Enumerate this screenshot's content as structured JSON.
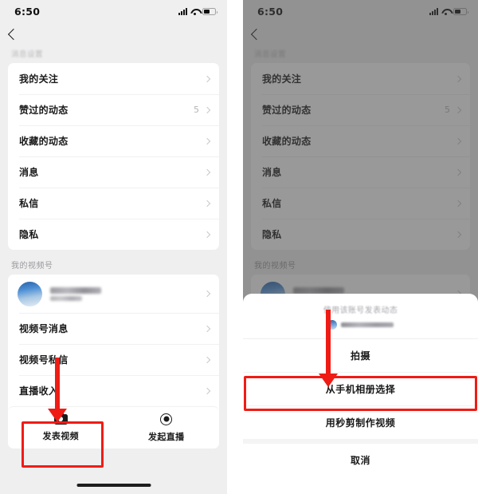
{
  "meta": {
    "status_time": "6:50",
    "accent_red": "#ef1c15",
    "panel_bg": "#efeff0",
    "card_bg": "#ffffff"
  },
  "icons": {
    "back": "back-chevron-icon",
    "signal": "signal-bars-icon",
    "wifi": "wifi-icon",
    "battery": "battery-icon",
    "camera": "camera-icon",
    "live": "live-broadcast-icon",
    "chevron": "chevron-right-icon"
  },
  "left_phone": {
    "section_one_title": "消息设置",
    "settings_rows": [
      {
        "label": "我的关注",
        "value": ""
      },
      {
        "label": "赞过的动态",
        "value": "5"
      },
      {
        "label": "收藏的动态",
        "value": ""
      },
      {
        "label": "消息",
        "value": ""
      },
      {
        "label": "私信",
        "value": ""
      },
      {
        "label": "隐私",
        "value": ""
      }
    ],
    "section_two_title": "我的视频号",
    "profile": {
      "name": "",
      "subtitle": ""
    },
    "channel_rows": [
      {
        "label": "视频号消息",
        "value": ""
      },
      {
        "label": "视频号私信",
        "value": ""
      },
      {
        "label": "直播收入",
        "value": ""
      }
    ],
    "actions": [
      {
        "label": "发表视频",
        "icon": "camera-icon"
      },
      {
        "label": "发起直播",
        "icon": "live-broadcast-icon"
      }
    ]
  },
  "right_phone": {
    "section_one_title": "消息设置",
    "settings_rows": [
      {
        "label": "我的关注",
        "value": ""
      },
      {
        "label": "赞过的动态",
        "value": "5"
      },
      {
        "label": "收藏的动态",
        "value": ""
      },
      {
        "label": "消息",
        "value": ""
      },
      {
        "label": "私信",
        "value": ""
      },
      {
        "label": "隐私",
        "value": ""
      }
    ],
    "section_two_title": "我的视频号",
    "sheet": {
      "header_title": "使用该账号发表动态",
      "items": [
        {
          "label": "拍摄"
        },
        {
          "label": "从手机相册选择"
        },
        {
          "label": "用秒剪制作视频"
        }
      ],
      "cancel_label": "取消"
    }
  }
}
